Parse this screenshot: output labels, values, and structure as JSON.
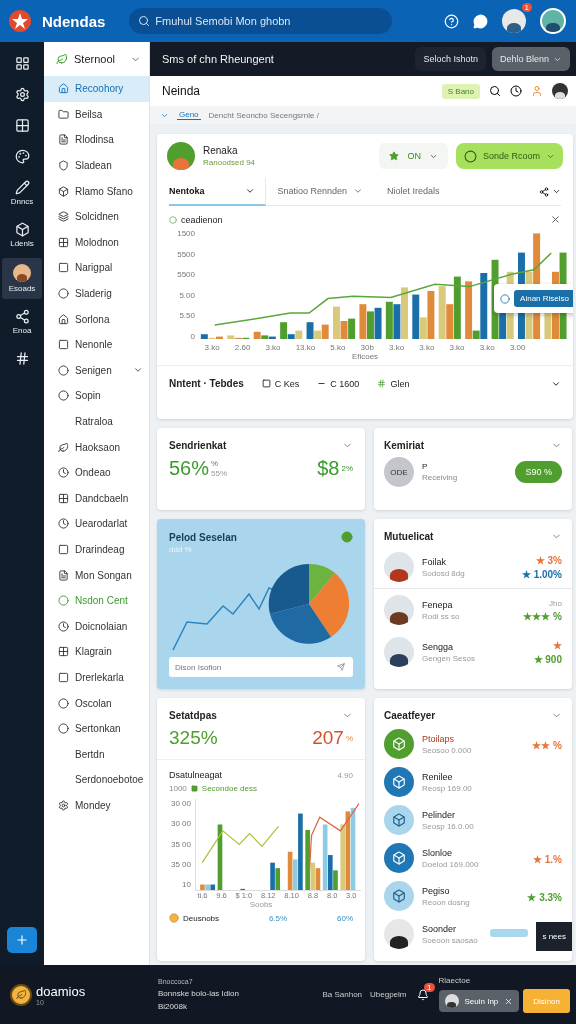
{
  "topbar": {
    "brand": "Ndendas",
    "search": {
      "placeholder": "Fmuhul Semobi Mon ghobn"
    },
    "notification_count": "1"
  },
  "rail": {
    "items": [
      {
        "selected": false
      },
      {
        "selected": false
      },
      {
        "selected": false
      },
      {
        "selected": false
      },
      {
        "label": "Dnncs",
        "selected": false
      },
      {
        "label": "Ldenls",
        "selected": false
      },
      {
        "label": "Esoads",
        "selected": true
      },
      {
        "label": "Enoa",
        "selected": false
      },
      {
        "selected": false
      }
    ]
  },
  "sidebar": {
    "title": "Sternool",
    "items": [
      {
        "label": "Recoohory",
        "selected": true,
        "icon": true
      },
      {
        "label": "Beilsa",
        "selected": false,
        "icon": true
      },
      {
        "label": "Rlodinsa",
        "selected": false,
        "icon": true
      },
      {
        "label": "Sladean",
        "selected": false,
        "icon": true
      },
      {
        "label": "Rlamo Sfano",
        "selected": false,
        "icon": true
      },
      {
        "label": "Solcidnen",
        "selected": false,
        "icon": true
      },
      {
        "label": "Molodnon",
        "selected": false,
        "icon": true
      },
      {
        "label": "Narigpal",
        "selected": false,
        "icon": true
      },
      {
        "label": "Sladerig",
        "selected": false,
        "icon": true
      },
      {
        "label": "Sorlona",
        "selected": false,
        "icon": true
      },
      {
        "label": "Nenonle",
        "selected": false,
        "icon": true
      },
      {
        "label": "Senigen",
        "selected": false,
        "icon": true,
        "expandable": true
      },
      {
        "label": "Sopin",
        "selected": false,
        "icon": true
      },
      {
        "label": "Ratraloa",
        "selected": false,
        "icon": false
      },
      {
        "label": "Haoksaon",
        "selected": false,
        "icon": true
      },
      {
        "label": "Ondeao",
        "selected": false,
        "icon": true
      },
      {
        "label": "Dandcbaeln",
        "selected": false,
        "icon": true
      },
      {
        "label": "Uearodarlat",
        "selected": false,
        "icon": true
      },
      {
        "label": "Drarindeag",
        "selected": false,
        "icon": true
      },
      {
        "label": "Mon Songan",
        "selected": false,
        "icon": true
      },
      {
        "label": "Nsdon Cent",
        "selected": false,
        "icon": true,
        "highlight": true
      },
      {
        "label": "Doicnolaian",
        "selected": false,
        "icon": true
      },
      {
        "label": "Klagrain",
        "selected": false,
        "icon": true
      },
      {
        "label": "Drerlekarla",
        "selected": false,
        "icon": true
      },
      {
        "label": "Oscolan",
        "selected": false,
        "icon": true
      },
      {
        "label": "Sertonkan",
        "selected": false,
        "icon": true
      },
      {
        "label": "Bertdn",
        "selected": false,
        "icon": false
      },
      {
        "label": "Serdonoebotoe",
        "selected": false,
        "icon": false
      },
      {
        "label": "Mondey",
        "selected": false,
        "icon": true
      }
    ]
  },
  "toolbar": {
    "title": "Sms of chn Rheungent",
    "buttons": [
      {
        "label": "Seloch Ishotn",
        "kind": "plain"
      },
      {
        "label": "Dehlo Blenn",
        "kind": "menu"
      }
    ]
  },
  "header": {
    "title": "Neinda",
    "badge": "S Bano"
  },
  "breadcrumb": {
    "tab": "Geno",
    "path": "Dencht Seoncbo Secengsrnle /"
  },
  "profile": {
    "name": "Renaka",
    "subtitle": "Ranoodsed 94",
    "filter": "ON",
    "action": "Sonde Rcoom"
  },
  "tabs": [
    {
      "label": "Nentoka",
      "selected": true,
      "dropdown": true
    },
    {
      "label": "Snatioo Rennden",
      "selected": false,
      "dropdown": true
    },
    {
      "label": "Niolet Iredals",
      "selected": false,
      "dropdown": false
    }
  ],
  "main_chart": {
    "title": "ceadienon",
    "y_labels": [
      "1500",
      "5500",
      "5500",
      "5.00",
      "5.50",
      "0"
    ],
    "x_labels": [
      "3.ko",
      "2.60",
      "3.ko",
      "13.ko",
      "5.ko",
      "30b",
      "3.ko",
      "3.ko",
      "3.ko",
      "3.ko",
      "3.00"
    ],
    "x_title": "Eficoes",
    "tooltip": "Ainan Riselso"
  },
  "summary": [
    {
      "label": "Nntent · Tebdes",
      "kind": "title"
    },
    {
      "label": "C Kes",
      "kind": "square"
    },
    {
      "label": "C 1600",
      "kind": "dash"
    },
    {
      "label": "Glen",
      "kind": "green"
    }
  ],
  "stat_card": {
    "title": "Sendrienkat",
    "value": "56%",
    "value_note": "%",
    "value_sub": "55%",
    "amount": "$8",
    "amount_note": "2%"
  },
  "contact_card": {
    "title": "Kemiriat",
    "initials": "ODE",
    "name": "P",
    "status": "Receiving",
    "pill": "S90 %"
  },
  "pie_card": {
    "title": "Pelod Seselan",
    "subtitle": "ddd %",
    "placeholder": "Dison Isofion"
  },
  "people_card": {
    "title": "Mutuelicat",
    "people": [
      {
        "name": "Foilak",
        "sub": "Sodosd 8dg",
        "ratings": [
          {
            "color": "#e8743b",
            "text": "★ 3%"
          },
          {
            "color": "#1a6fa8",
            "text": "★ 1.00%"
          }
        ]
      },
      {
        "name": "Fenepa",
        "sub": "Rodi ss so",
        "note": "Jho",
        "ratings": [
          {
            "color": "#4f9e2e",
            "text": "★★★ %"
          }
        ]
      },
      {
        "name": "Sengga",
        "sub": "Gengen Sesos",
        "ratings": [
          {
            "color": "#e8743b",
            "text": "★"
          },
          {
            "color": "#4f9e2e",
            "text": "★ 900"
          }
        ]
      }
    ]
  },
  "growth_card": {
    "title": "Setatdpas",
    "value": "325%",
    "amount": "207",
    "amount_note": "%",
    "chart_title": "Dsatulneagat",
    "chart_note": "4.90",
    "legend": "Secondoe dess",
    "legend_value": "1000",
    "y_labels": [
      "30 00",
      "30 00",
      "35 00",
      "35 00",
      "10"
    ],
    "x_labels": [
      "ti.6",
      "9.6",
      "$ 1:0",
      "8.12",
      "8.10",
      "8.8",
      "8.0",
      "3.0"
    ],
    "x_title": "Soobs",
    "footer": "Deusnobs",
    "footer_values": [
      "6.5%",
      "60%"
    ]
  },
  "list_card": {
    "title": "Caeatfeyer",
    "items": [
      {
        "name": "Ptoilaps",
        "sub": "Seosoo 0.000",
        "kind": "green",
        "rating": {
          "color": "#e8743b",
          "text": "★★ %"
        }
      },
      {
        "name": "Renilee",
        "sub": "Reosp 169.00",
        "kind": "blue"
      },
      {
        "name": "Pelinder",
        "sub": "Seosp 16.0.00",
        "kind": "light"
      },
      {
        "name": "Slonloe",
        "sub": "Doelod 169.000",
        "kind": "blue",
        "rating": {
          "color": "#e8743b",
          "text": "★ 1.%"
        }
      },
      {
        "name": "Pegiso",
        "sub": "Reoon dosng",
        "kind": "light",
        "rating": {
          "color": "#4f9e2e",
          "text": "★ 3.3%"
        }
      },
      {
        "name": "Soonder",
        "sub": "Soeoon saosao",
        "kind": "person"
      }
    ],
    "action": "s nees"
  },
  "footer": {
    "brand": "doamios",
    "brand_sub": "10",
    "small": "Bnoccoca7",
    "line1": "Bonnske bolo-las Idion",
    "line2": "Bi2008k",
    "links": [
      "Ba Sanhon",
      "Ubegpelm"
    ],
    "badge": "1",
    "right_title": "Rlaectoe",
    "chip": "Seuin Inp",
    "button": "Disinon"
  }
}
